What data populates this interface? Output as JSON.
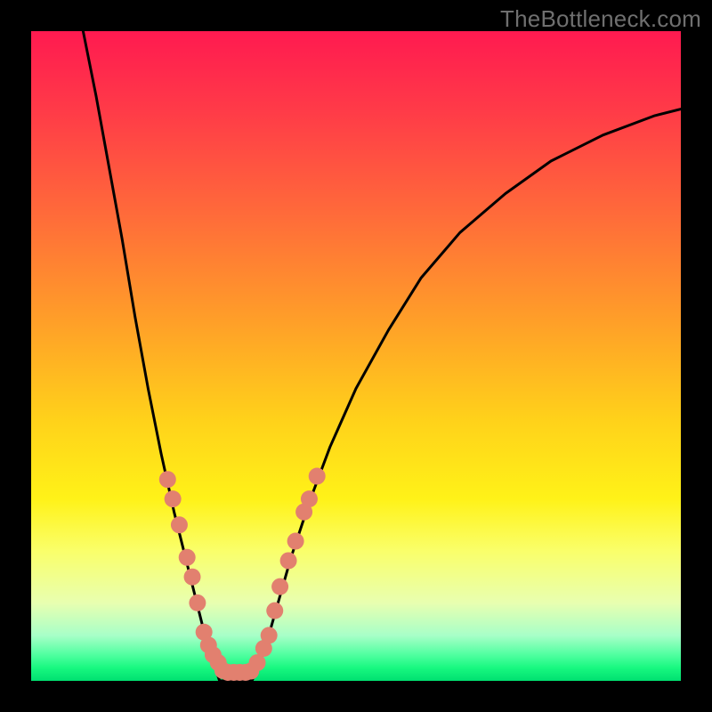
{
  "watermark": "TheBottleneck.com",
  "chart_data": {
    "type": "line",
    "title": "",
    "xlabel": "",
    "ylabel": "",
    "xlim": [
      0,
      100
    ],
    "ylim": [
      0,
      100
    ],
    "background_gradient": {
      "top_color": "#ff1a50",
      "mid_color": "#ffd21a",
      "bottom_color": "#00e070"
    },
    "series": [
      {
        "name": "left-curve",
        "stroke": "#000000",
        "x": [
          8,
          10,
          12,
          14,
          16,
          18,
          20,
          22,
          24,
          26,
          27,
          28,
          29
        ],
        "y": [
          100,
          90,
          79,
          68,
          56,
          45,
          35,
          26,
          18,
          10,
          6,
          3,
          0
        ]
      },
      {
        "name": "valley-floor",
        "stroke": "#000000",
        "x": [
          29,
          30,
          31,
          32,
          33,
          34
        ],
        "y": [
          0,
          0,
          0,
          0,
          0,
          0
        ]
      },
      {
        "name": "right-curve",
        "stroke": "#000000",
        "x": [
          34,
          36,
          38,
          40,
          43,
          46,
          50,
          55,
          60,
          66,
          73,
          80,
          88,
          96,
          100
        ],
        "y": [
          0,
          5,
          12,
          19,
          28,
          36,
          45,
          54,
          62,
          69,
          75,
          80,
          84,
          87,
          88
        ]
      }
    ],
    "markers": [
      {
        "name": "left-cluster",
        "color": "#e2806f",
        "radius_pct": 1.3,
        "points": [
          {
            "x": 21.0,
            "y": 31.0
          },
          {
            "x": 21.8,
            "y": 28.0
          },
          {
            "x": 22.8,
            "y": 24.0
          },
          {
            "x": 24.0,
            "y": 19.0
          },
          {
            "x": 24.8,
            "y": 16.0
          },
          {
            "x": 25.6,
            "y": 12.0
          },
          {
            "x": 26.6,
            "y": 7.5
          },
          {
            "x": 27.3,
            "y": 5.5
          },
          {
            "x": 28.0,
            "y": 4.0
          },
          {
            "x": 28.8,
            "y": 2.8
          }
        ]
      },
      {
        "name": "floor-cluster",
        "color": "#e2806f",
        "radius_pct": 1.3,
        "points": [
          {
            "x": 29.5,
            "y": 1.6
          },
          {
            "x": 30.3,
            "y": 1.3
          },
          {
            "x": 31.2,
            "y": 1.3
          },
          {
            "x": 32.1,
            "y": 1.3
          },
          {
            "x": 33.0,
            "y": 1.3
          },
          {
            "x": 33.8,
            "y": 1.5
          }
        ]
      },
      {
        "name": "right-cluster",
        "color": "#e2806f",
        "radius_pct": 1.3,
        "points": [
          {
            "x": 34.8,
            "y": 2.8
          },
          {
            "x": 35.8,
            "y": 5.0
          },
          {
            "x": 36.6,
            "y": 7.0
          },
          {
            "x": 37.5,
            "y": 10.8
          },
          {
            "x": 38.3,
            "y": 14.5
          },
          {
            "x": 39.6,
            "y": 18.5
          },
          {
            "x": 40.7,
            "y": 21.5
          },
          {
            "x": 42.0,
            "y": 26.0
          },
          {
            "x": 42.8,
            "y": 28.0
          },
          {
            "x": 44.0,
            "y": 31.5
          }
        ]
      }
    ]
  }
}
